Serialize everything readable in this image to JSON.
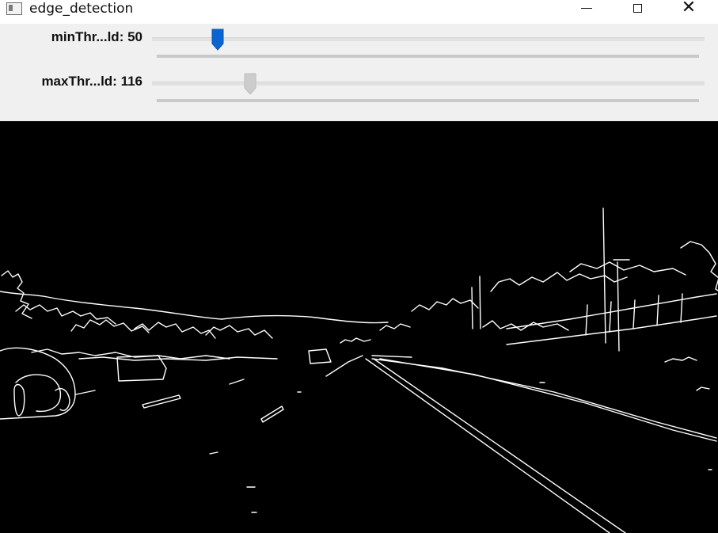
{
  "window": {
    "title": "edge_detection",
    "icon": "app-window-icon",
    "controls": [
      "minimize-icon",
      "maximize-icon",
      "close-icon"
    ],
    "close_glyph": "✕"
  },
  "trackbars": [
    {
      "label": "minThr...ld: 50",
      "value": 50,
      "max": 255,
      "position_fraction": 0.06,
      "thumb_color": "#0a64d2",
      "active": true
    },
    {
      "label": "maxThr...ld: 116",
      "value": 116,
      "max": 255,
      "position_fraction": 0.12,
      "thumb_color": "#cccccc",
      "active": false
    }
  ],
  "image": {
    "description_name": "canny-edge-output",
    "background": "#000000",
    "edge_color": "#ffffff"
  }
}
